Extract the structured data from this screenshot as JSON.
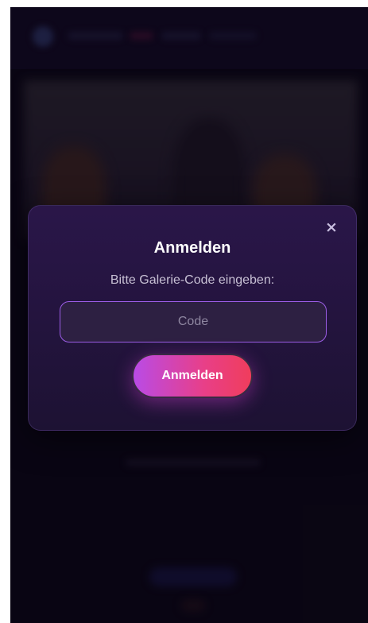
{
  "modal": {
    "close_label": "×",
    "title": "Anmelden",
    "subtitle": "Bitte Galerie-Code eingeben:",
    "code_input": {
      "value": "",
      "placeholder": "Code"
    },
    "submit_label": "Anmelden"
  },
  "colors": {
    "accent_start": "#b94be6",
    "accent_end": "#f03d5c",
    "modal_bg": "#241540",
    "input_border": "#9b5de5"
  }
}
